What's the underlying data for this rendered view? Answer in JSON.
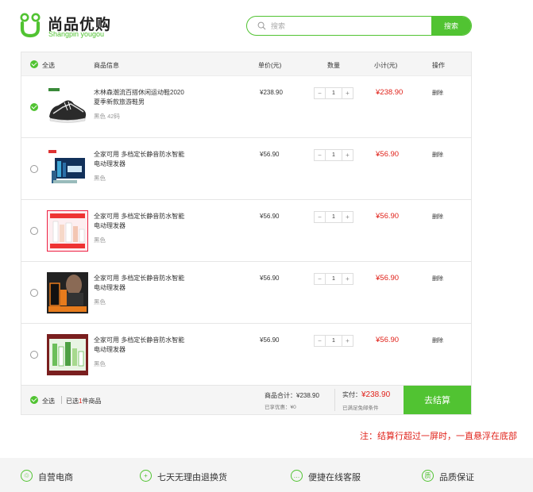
{
  "colors": {
    "accent": "#51c332",
    "price_red": "#e0231b"
  },
  "header": {
    "logo_cn": "尚品优购",
    "logo_en": "Shangpin yougou",
    "search_placeholder": "搜索",
    "search_button": "搜索"
  },
  "cart": {
    "columns": {
      "select_all": "全选",
      "product_info": "商品信息",
      "unit_price": "单价(元)",
      "quantity": "数量",
      "subtotal": "小计(元)",
      "action": "操作"
    },
    "items": [
      {
        "name": "木林森潮流百搭休闲运动鞋2020夏季新款旅游鞋男",
        "spec": "黑色   42码",
        "price": "¥238.90",
        "qty": "1",
        "subtotal": "¥238.90",
        "delete": "删除",
        "checked": true,
        "image": "sneaker-photo",
        "minus": "−",
        "plus": "+"
      },
      {
        "name": "全家可用 多档定长静音防水智能电动理发器",
        "spec": "黑色",
        "price": "¥56.90",
        "qty": "1",
        "subtotal": "¥56.90",
        "delete": "删除",
        "checked": false,
        "image": "skincare-box-photo",
        "minus": "−",
        "plus": "+"
      },
      {
        "name": "全家可用 多档定长静音防水智能电动理发器",
        "spec": "黑色",
        "price": "¥56.90",
        "qty": "1",
        "subtotal": "¥56.90",
        "delete": "删除",
        "checked": false,
        "image": "skincare-set-photo",
        "minus": "−",
        "plus": "+"
      },
      {
        "name": "全家可用 多档定长静音防水智能电动理发器",
        "spec": "黑色",
        "price": "¥56.90",
        "qty": "1",
        "subtotal": "¥56.90",
        "delete": "删除",
        "checked": false,
        "image": "mens-skincare-photo",
        "minus": "−",
        "plus": "+"
      },
      {
        "name": "全家可用 多档定长静音防水智能电动理发器",
        "spec": "黑色",
        "price": "¥56.90",
        "qty": "1",
        "subtotal": "¥56.90",
        "delete": "删除",
        "checked": false,
        "image": "green-skincare-photo",
        "minus": "−",
        "plus": "+"
      }
    ],
    "footer": {
      "select_all": "全选",
      "selected_prefix": "已选",
      "selected_count": "1",
      "selected_suffix": "件商品",
      "goods_total_label": "商品合计：",
      "goods_total": "¥238.90",
      "discount_label": "已享优惠：",
      "discount": "¥0",
      "pay_label": "实付：",
      "pay_total": "¥238.90",
      "shipping_note": "已满足免邮条件",
      "checkout": "去结算"
    }
  },
  "note": "注：结算行超过一屏时，一直悬浮在底部",
  "services": [
    {
      "icon": "gift-icon",
      "glyph": "♲",
      "label": "自营电商"
    },
    {
      "icon": "plus-circle-icon",
      "glyph": "+",
      "label": "七天无理由退换货"
    },
    {
      "icon": "chat-icon",
      "glyph": "…",
      "label": "便捷在线客服"
    },
    {
      "icon": "quality-icon",
      "glyph": "质",
      "label": "品质保证"
    }
  ]
}
